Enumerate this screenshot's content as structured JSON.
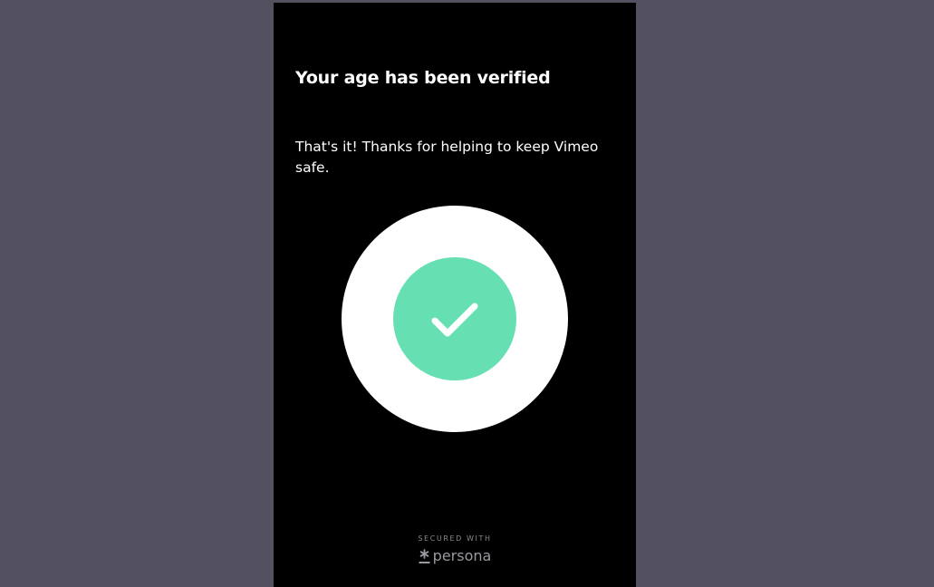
{
  "page": {
    "background_color": "#53515f"
  },
  "modal": {
    "background_color": "#000000",
    "title": "Your age has been verified",
    "subtitle": "That's it! Thanks for helping to keep Vimeo safe.",
    "status_icon": {
      "name": "checkmark-icon",
      "outer_color": "#ffffff",
      "inner_color": "#66dfb3"
    },
    "footer": {
      "secured_label": "SECURED WITH",
      "brand_icon": "asterisk-logo-icon",
      "brand_name": "persona"
    }
  }
}
